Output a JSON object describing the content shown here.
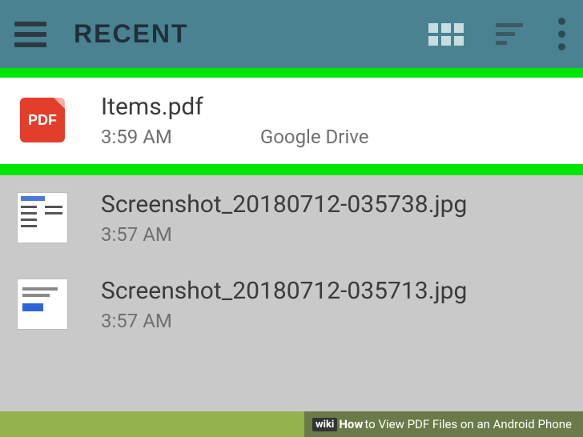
{
  "appbar": {
    "title": "RECENT"
  },
  "files": [
    {
      "name": "Items.pdf",
      "time": "3:59 AM",
      "source": "Google Drive",
      "pdf_label": "PDF"
    },
    {
      "name": "Screenshot_20180712-035738.jpg",
      "time": "3:57 AM",
      "source": ""
    },
    {
      "name": "Screenshot_20180712-035713.jpg",
      "time": "3:57 AM",
      "source": ""
    }
  ],
  "caption": {
    "wiki": "wiki",
    "how": "How",
    "text": " to View PDF Files on an Android Phone"
  }
}
